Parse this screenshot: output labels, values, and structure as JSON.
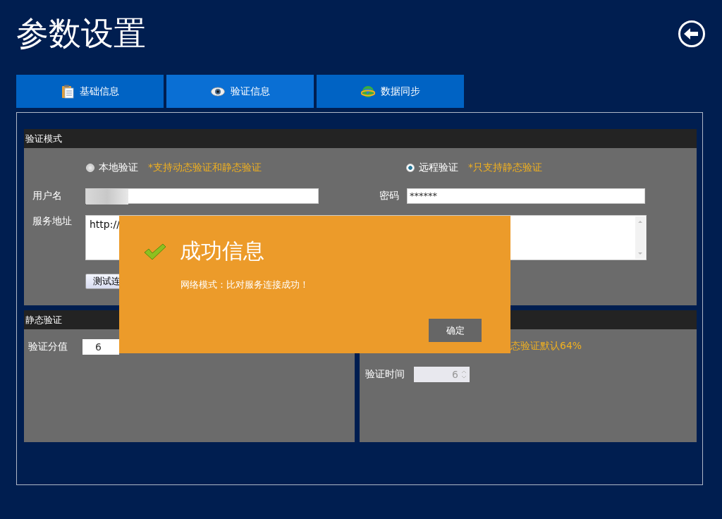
{
  "title": "参数设置",
  "tabs": [
    {
      "label": "基础信息",
      "selected": false
    },
    {
      "label": "验证信息",
      "selected": true
    },
    {
      "label": "数据同步",
      "selected": false
    }
  ],
  "mode_section": {
    "title": "验证模式",
    "options": [
      {
        "label": "本地验证",
        "hint": "*支持动态验证和静态验证",
        "selected": false
      },
      {
        "label": "远程验证",
        "hint": "*只支持静态验证",
        "selected": true
      }
    ],
    "username_label": "用户名",
    "password_label": "密码",
    "password_value": "******",
    "address_label": "服务地址",
    "address_value": "http://",
    "test_button": "测试连"
  },
  "static_section": {
    "title": "静态验证",
    "score_label": "验证分值",
    "score_value": "6"
  },
  "dynamic_section": {
    "hint": "态验证默认64%",
    "time_label": "验证时间",
    "time_value": "6"
  },
  "dialog": {
    "title": "成功信息",
    "message": "网络模式：比对服务连接成功！",
    "ok_button": "确定"
  }
}
